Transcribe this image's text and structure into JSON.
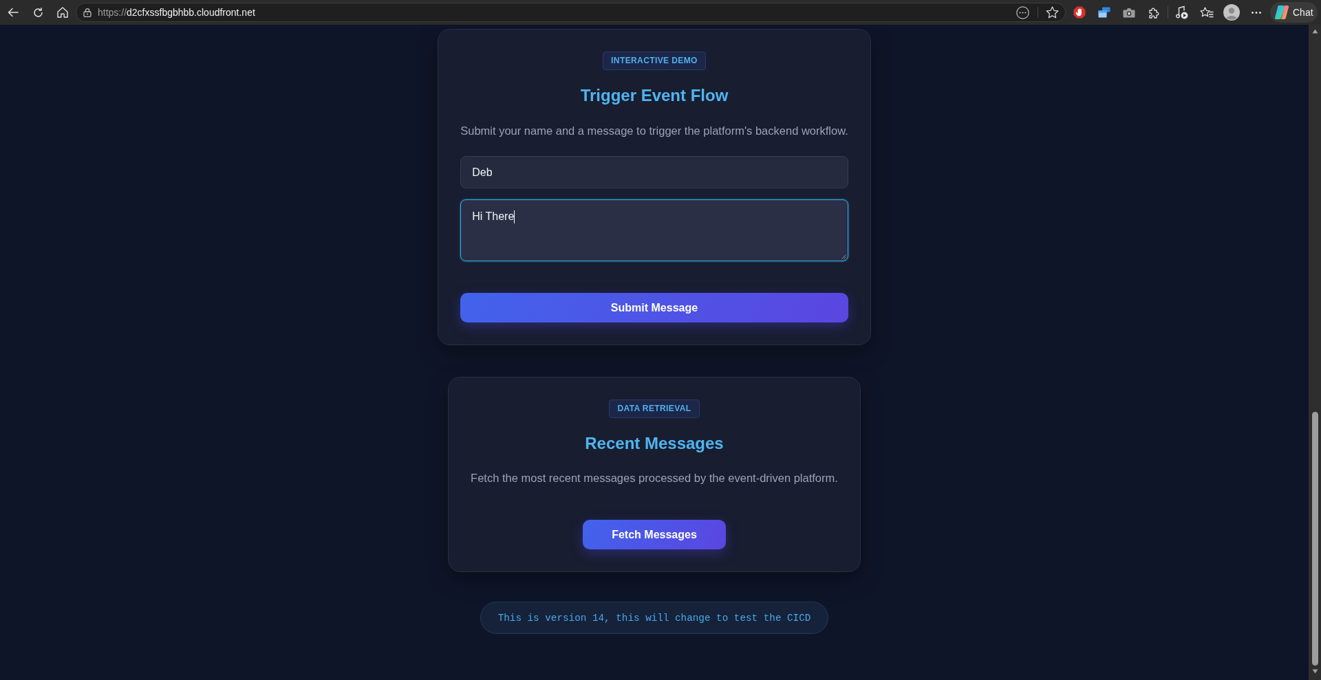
{
  "browser": {
    "url_scheme": "https://",
    "url_host": "d2cfxssfbgbhbb.cloudfront.net",
    "chat_label": "Chat"
  },
  "cards": [
    {
      "kind": "form",
      "badge": "INTERACTIVE DEMO",
      "title": "Trigger Event Flow",
      "description": "Submit your name and a message to trigger the platform's backend workflow.",
      "fields": [
        {
          "kind": "input",
          "value": "Deb",
          "focused": false
        },
        {
          "kind": "textarea",
          "value": "Hi There",
          "focused": true
        }
      ],
      "button": "Submit Message"
    },
    {
      "kind": "action",
      "badge": "DATA RETRIEVAL",
      "title": "Recent Messages",
      "description": "Fetch the most recent messages processed by the event-driven platform.",
      "button": "Fetch Messages"
    }
  ],
  "footer": {
    "text": "This is version 14, this will change to test the CICD"
  }
}
